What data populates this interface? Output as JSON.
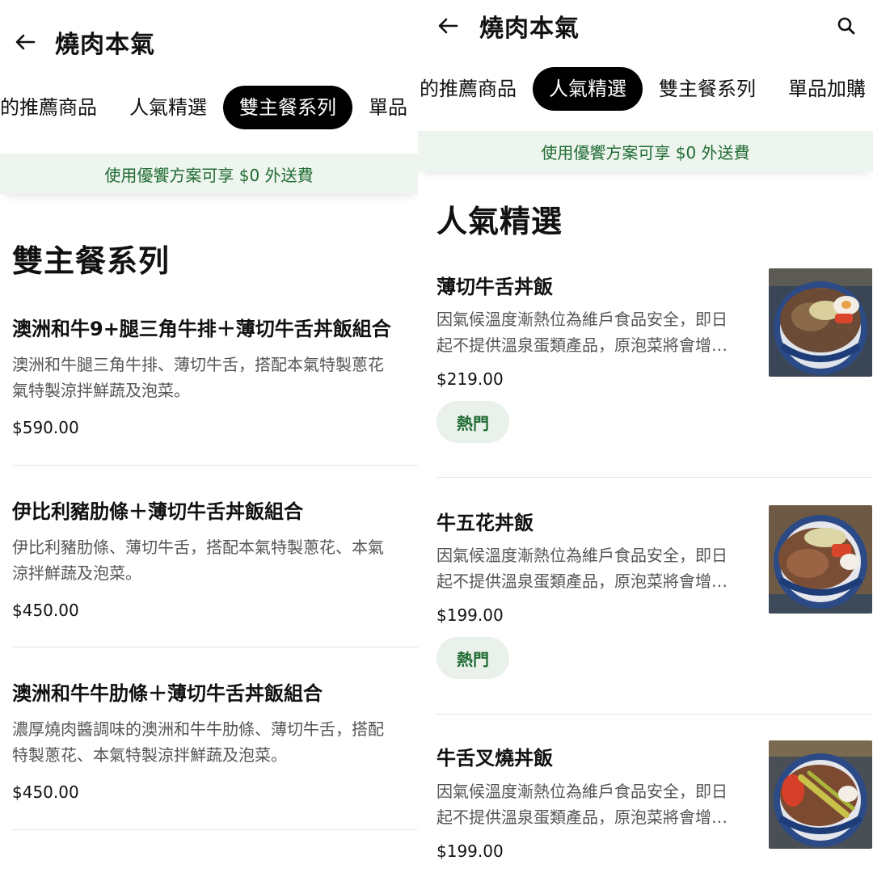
{
  "left": {
    "store_title": "燒肉本氣",
    "tabs": [
      {
        "label": "的推薦商品"
      },
      {
        "label": "人氣精選"
      },
      {
        "label": "雙主餐系列"
      },
      {
        "label": "單品"
      }
    ],
    "active_tab": "雙主餐系列",
    "banner": "使用優饗方案可享 $0 外送費",
    "section_title": "雙主餐系列",
    "items": [
      {
        "name": "澳洲和牛9+腿三角牛排＋薄切牛舌丼飯組合",
        "desc_line1": "澳洲和牛腿三角牛排、薄切牛舌，搭配本氣特製蔥花",
        "desc_line2": "氣特製涼拌鮮蔬及泡菜。",
        "price": "$590.00"
      },
      {
        "name": "伊比利豬肋條＋薄切牛舌丼飯組合",
        "desc_line1": "伊比利豬肋條、薄切牛舌，搭配本氣特製蔥花、本氣",
        "desc_line2": "涼拌鮮蔬及泡菜。",
        "price": "$450.00"
      },
      {
        "name": "澳洲和牛牛肋條＋薄切牛舌丼飯組合",
        "desc_line1": "濃厚燒肉醬調味的澳洲和牛牛肋條、薄切牛舌，搭配",
        "desc_line2": "特製蔥花、本氣特製涼拌鮮蔬及泡菜。",
        "price": "$450.00"
      }
    ]
  },
  "right": {
    "store_title": "燒肉本氣",
    "tabs": [
      {
        "label": "的推薦商品"
      },
      {
        "label": "人氣精選"
      },
      {
        "label": "雙主餐系列"
      },
      {
        "label": "單品加購"
      }
    ],
    "active_tab": "人氣精選",
    "banner": "使用優饗方案可享 $0 外送費",
    "section_title": "人氣精選",
    "items": [
      {
        "name": "薄切牛舌丼飯",
        "desc_line1": "因氣候溫度漸熱位為維戶食品安全，即日",
        "desc_line2": "起不提供溫泉蛋類產品，原泡菜將會增…",
        "price": "$219.00",
        "badge": "熱門"
      },
      {
        "name": "牛五花丼飯",
        "desc_line1": "因氣候溫度漸熱位為維戶食品安全，即日",
        "desc_line2": "起不提供溫泉蛋類產品，原泡菜將會增…",
        "price": "$199.00",
        "badge": "熱門"
      },
      {
        "name": "牛舌叉燒丼飯",
        "desc_line1": "因氣候溫度漸熱位為維戶食品安全，即日",
        "desc_line2": "起不提供溫泉蛋類產品，原泡菜將會增…",
        "price": "$199.00"
      }
    ]
  },
  "colors": {
    "accent_green": "#1f6b33",
    "banner_bg": "#eef5ee",
    "badge_bg": "#e9f1ea",
    "active_tab_bg": "#000000"
  }
}
